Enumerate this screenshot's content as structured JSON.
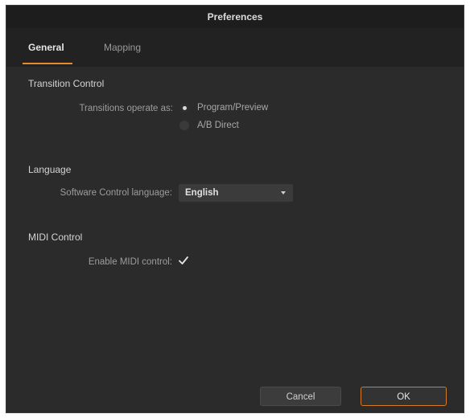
{
  "window": {
    "title": "Preferences"
  },
  "tabs": [
    {
      "label": "General",
      "active": true
    },
    {
      "label": "Mapping",
      "active": false
    }
  ],
  "transition_control": {
    "section_title": "Transition Control",
    "field_label": "Transitions operate as:",
    "options": [
      {
        "label": "Program/Preview",
        "selected": true
      },
      {
        "label": "A/B Direct",
        "selected": false
      }
    ]
  },
  "language": {
    "section_title": "Language",
    "field_label": "Software Control language:",
    "selected_value": "English"
  },
  "midi_control": {
    "section_title": "MIDI Control",
    "field_label": "Enable MIDI control:",
    "enabled": true
  },
  "buttons": {
    "cancel_label": "Cancel",
    "ok_label": "OK"
  },
  "colors": {
    "accent": "#e58a2b",
    "background": "#2b2b2b",
    "titlebar": "#1d1d1d"
  },
  "icons": {
    "checkmark": "check-icon",
    "dropdown": "chevron-down-icon"
  }
}
